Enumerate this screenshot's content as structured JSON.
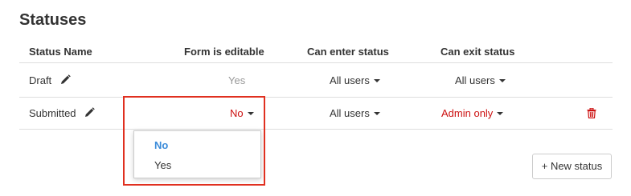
{
  "page": {
    "title": "Statuses"
  },
  "table": {
    "headers": {
      "status_name": "Status Name",
      "form_editable": "Form is editable",
      "can_enter": "Can enter status",
      "can_exit": "Can exit status"
    },
    "rows": [
      {
        "name": "Draft",
        "form_editable": "Yes",
        "can_enter": "All users",
        "can_exit": "All users"
      },
      {
        "name": "Submitted",
        "form_editable": "No",
        "can_enter": "All users",
        "can_exit": "Admin only"
      }
    ]
  },
  "dropdown": {
    "options": [
      "No",
      "Yes"
    ],
    "selected": "No"
  },
  "actions": {
    "new_status_label": "+ New status"
  },
  "icons": {
    "edit": "pencil-icon",
    "delete": "trash-icon",
    "caret": "caret-down-icon"
  },
  "colors": {
    "danger": "#cc1111",
    "selected_option": "#3b8bd9",
    "highlight": "#e03020"
  }
}
